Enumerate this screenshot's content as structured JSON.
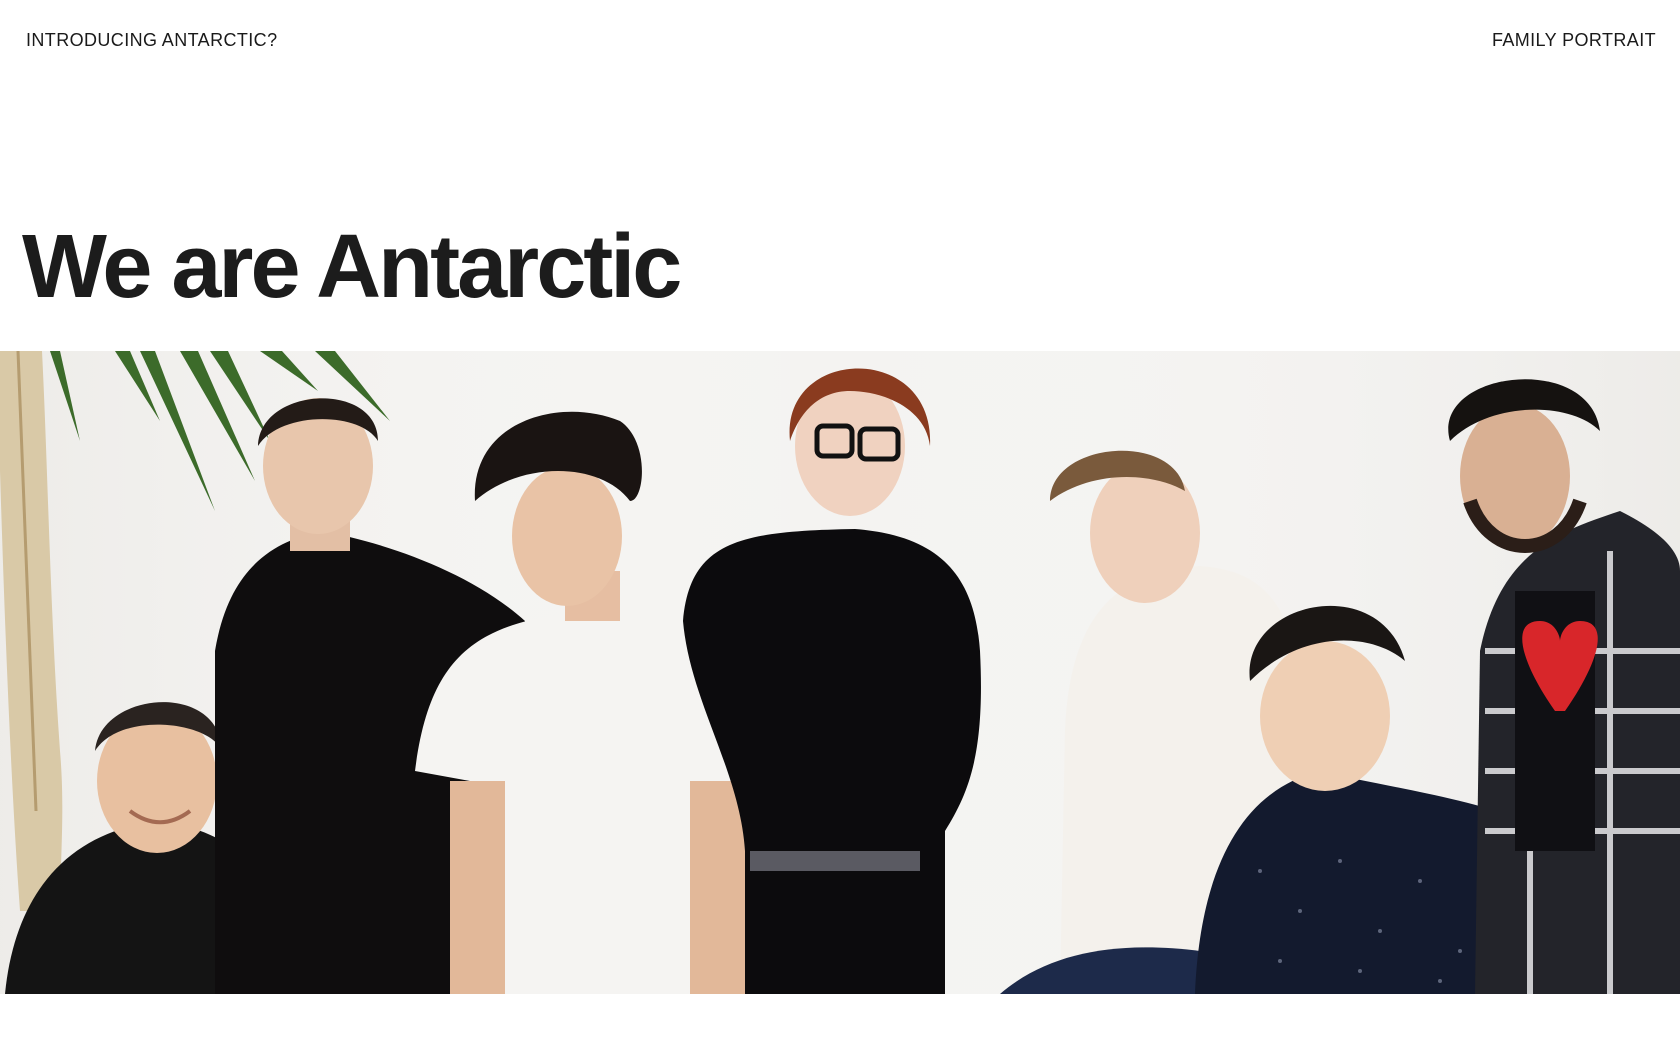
{
  "nav": {
    "left_label": "INTRODUCING ANTARCTIC?",
    "right_label": "FAMILY PORTRAIT"
  },
  "hero": {
    "headline": "We are Antarctic"
  },
  "photo": {
    "subject": "team-portrait",
    "people_count": 7
  },
  "colors": {
    "text": "#1a1a1a",
    "background": "#ffffff",
    "wall": "#f3f2f0"
  }
}
